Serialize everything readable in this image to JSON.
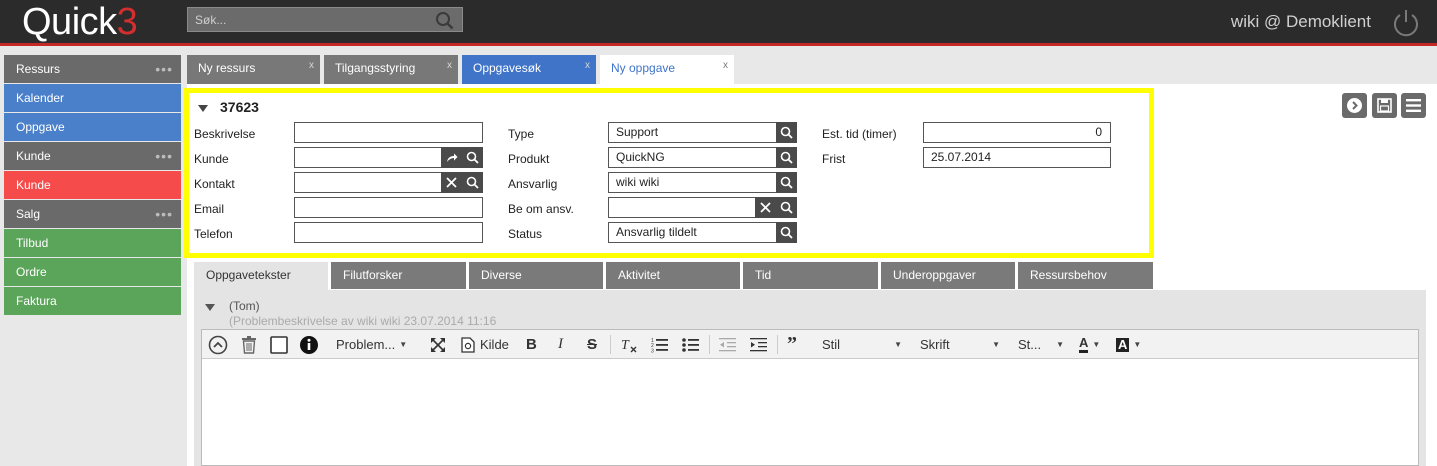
{
  "app": {
    "logo_text": "Quick",
    "logo_num": "3",
    "user": "wiki @ Demoklient"
  },
  "search": {
    "placeholder": "Søk..."
  },
  "sidebar": {
    "items": [
      {
        "label": "Ressurs",
        "type": "head"
      },
      {
        "label": "Kalender",
        "type": "blue"
      },
      {
        "label": "Oppgave",
        "type": "blue"
      },
      {
        "label": "Kunde",
        "type": "head"
      },
      {
        "label": "Kunde",
        "type": "red"
      },
      {
        "label": "Salg",
        "type": "head"
      },
      {
        "label": "Tilbud",
        "type": "green"
      },
      {
        "label": "Ordre",
        "type": "green"
      },
      {
        "label": "Faktura",
        "type": "green"
      }
    ]
  },
  "tabs": [
    {
      "label": "Ny ressurs",
      "close": "x"
    },
    {
      "label": "Tilgangsstyring",
      "close": "x"
    },
    {
      "label": "Oppgavesøk",
      "close": "x"
    },
    {
      "label": "Ny oppgave",
      "close": "x"
    }
  ],
  "form": {
    "id": "37623",
    "beskrivelse": {
      "label": "Beskrivelse",
      "value": ""
    },
    "kunde": {
      "label": "Kunde",
      "value": ""
    },
    "kontakt": {
      "label": "Kontakt",
      "value": ""
    },
    "email": {
      "label": "Email",
      "value": ""
    },
    "telefon": {
      "label": "Telefon",
      "value": ""
    },
    "type": {
      "label": "Type",
      "value": "Support"
    },
    "produkt": {
      "label": "Produkt",
      "value": "QuickNG"
    },
    "ansvarlig": {
      "label": "Ansvarlig",
      "value": "wiki wiki"
    },
    "be_om_ansv": {
      "label": "Be om ansv.",
      "value": ""
    },
    "status": {
      "label": "Status",
      "value": "Ansvarlig tildelt"
    },
    "est_tid": {
      "label": "Est. tid (timer)",
      "value": "0"
    },
    "frist": {
      "label": "Frist",
      "value": "25.07.2014"
    }
  },
  "subtabs": [
    "Oppgavetekster",
    "Filutforsker",
    "Diverse",
    "Aktivitet",
    "Tid",
    "Underoppgaver",
    "Ressursbehov"
  ],
  "panel": {
    "tom": "(Tom)",
    "problem_desc": "(Problembeskrivelse av wiki wiki 23.07.2014 11:16"
  },
  "editor": {
    "template_label": "Problem...",
    "source_label": "Kilde",
    "style_label": "Stil",
    "font_label": "Skrift",
    "size_label": "St...",
    "text_color": "A",
    "bg_color": "A"
  },
  "colors": {
    "accent_red": "#d32f2f",
    "highlight": "#ffff00",
    "tab_blue": "#3f74c8"
  }
}
